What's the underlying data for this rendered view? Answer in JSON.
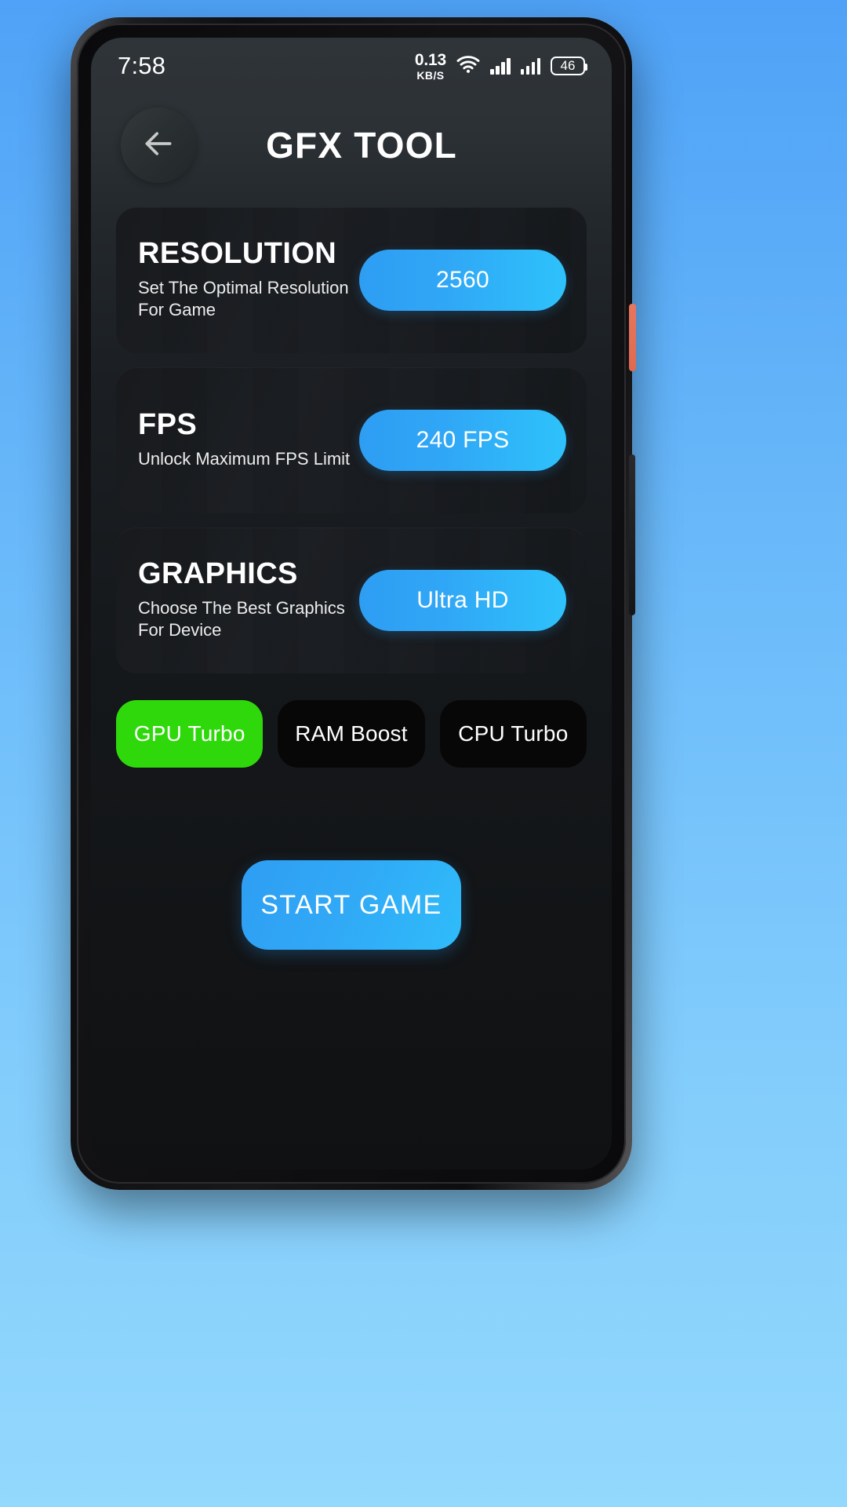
{
  "status_bar": {
    "time": "7:58",
    "net_rate": "0.13",
    "net_unit": "KB/S",
    "wifi_icon": "wifi-icon",
    "signal_1_icon": "signal-bars-sim1-icon",
    "signal_2_icon": "signal-bars-sim2-icon",
    "battery_level": "46"
  },
  "header": {
    "back_icon": "arrow-left-icon",
    "title": "GFX TOOL"
  },
  "cards": [
    {
      "title": "RESOLUTION",
      "subtitle": "Set The Optimal Resolution For Game",
      "value": "2560"
    },
    {
      "title": "FPS",
      "subtitle": "Unlock Maximum FPS Limit",
      "value": "240 FPS"
    },
    {
      "title": "GRAPHICS",
      "subtitle": "Choose The Best Graphics For Device",
      "value": "Ultra HD"
    }
  ],
  "toggles": [
    {
      "label": "GPU Turbo",
      "active": true
    },
    {
      "label": "RAM Boost",
      "active": false
    },
    {
      "label": "CPU Turbo",
      "active": false
    }
  ],
  "start_button": {
    "label": "START GAME"
  },
  "colors": {
    "accent_blue": "#2e9ef3",
    "accent_blue_light": "#2ec2fb",
    "active_green": "#2fd80b",
    "card_bg": "#17191c",
    "chip_bg": "#070707",
    "screen_bg": "#101215",
    "wallpaper_top": "#4fa2f7",
    "wallpaper_bottom": "#93d8fd",
    "power_button": "#e8765c"
  }
}
